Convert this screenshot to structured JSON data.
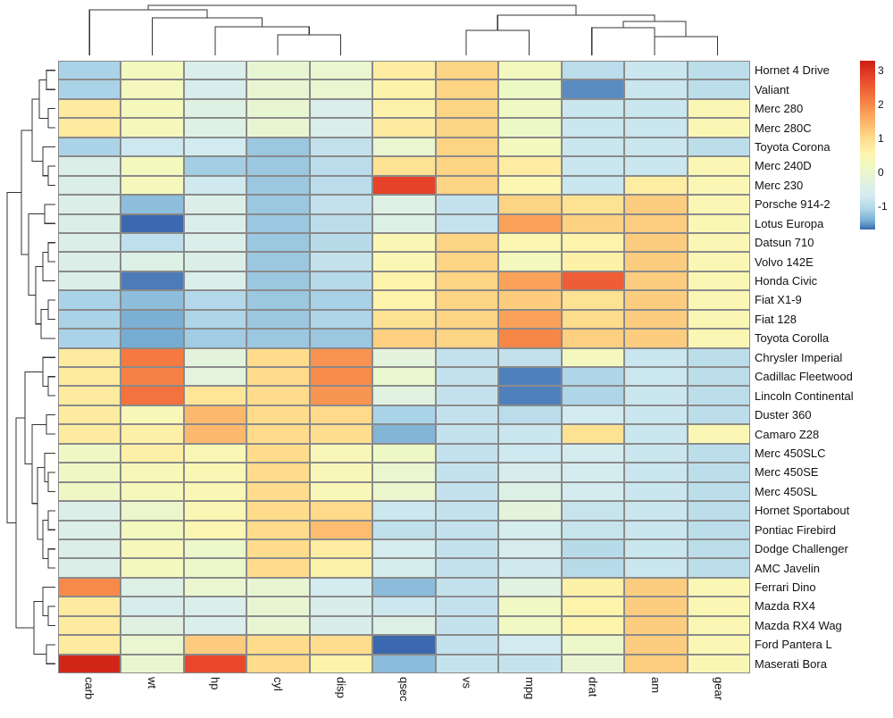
{
  "figure": {
    "type": "clustered-heatmap",
    "title": "",
    "grid_line_color": "#8a8a8a",
    "background": "#ffffff"
  },
  "legend": {
    "name": "color-key",
    "ticks": [
      "3",
      "2",
      "1",
      "0",
      "-1"
    ],
    "tick_values": [
      3,
      2,
      1,
      0,
      -1
    ],
    "scale_min": -1.7,
    "scale_max": 3.3,
    "stops": [
      {
        "pos": 0,
        "color": "#cc1e14"
      },
      {
        "pos": 0.1,
        "color": "#e8442b"
      },
      {
        "pos": 0.22,
        "color": "#f4773f"
      },
      {
        "pos": 0.34,
        "color": "#fbab60"
      },
      {
        "pos": 0.46,
        "color": "#fedd8d"
      },
      {
        "pos": 0.56,
        "color": "#fdf7b0"
      },
      {
        "pos": 0.64,
        "color": "#eef8c6"
      },
      {
        "pos": 0.72,
        "color": "#e2f2e0"
      },
      {
        "pos": 0.8,
        "color": "#d4ecf0"
      },
      {
        "pos": 0.88,
        "color": "#aed5e8"
      },
      {
        "pos": 0.95,
        "color": "#76acd2"
      },
      {
        "pos": 1.0,
        "color": "#3b68ae"
      }
    ]
  },
  "chart_data": {
    "type": "heatmap",
    "title": "",
    "xlabel": "",
    "ylabel": "",
    "zlim": [
      -1.7,
      3.3
    ],
    "grid": true,
    "legend_position": "right",
    "columns": [
      "carb",
      "wt",
      "hp",
      "cyl",
      "disp",
      "qsec",
      "vs",
      "mpg",
      "drat",
      "am",
      "gear"
    ],
    "rows": [
      "Hornet 4 Drive",
      "Valiant",
      "Merc 280",
      "Merc 280C",
      "Toyota Corona",
      "Merc 240D",
      "Merc 230",
      "Porsche 914-2",
      "Lotus Europa",
      "Datsun 710",
      "Volvo 142E",
      "Honda Civic",
      "Fiat X1-9",
      "Fiat 128",
      "Toyota Corolla",
      "Chrysler Imperial",
      "Cadillac Fleetwood",
      "Lincoln Continental",
      "Duster 360",
      "Camaro Z28",
      "Merc 450SLC",
      "Merc 450SE",
      "Merc 450SL",
      "Hornet Sportabout",
      "Pontiac Firebird",
      "Dodge Challenger",
      "AMC Javelin",
      "Ferrari Dino",
      "Mazda RX4",
      "Mazda RX4 Wag",
      "Ford Pantera L",
      "Maserati Bora"
    ],
    "values": [
      [
        -1.12,
        0.23,
        -0.54,
        -0.1,
        -0.06,
        0.72,
        1.12,
        0.22,
        -0.97,
        -0.81,
        -0.95
      ],
      [
        -1.12,
        0.25,
        -0.61,
        -0.1,
        -0.06,
        0.59,
        1.12,
        0.11,
        -1.57,
        -0.81,
        -0.95
      ],
      [
        0.74,
        0.29,
        -0.38,
        -0.1,
        -0.54,
        0.59,
        1.12,
        0.16,
        -0.81,
        -0.81,
        0.43
      ],
      [
        0.74,
        0.29,
        -0.38,
        -0.1,
        -0.54,
        0.73,
        1.12,
        0.1,
        -0.81,
        -0.81,
        0.43
      ],
      [
        -1.12,
        -0.77,
        -0.72,
        -1.22,
        -0.89,
        -0.06,
        1.12,
        0.23,
        -0.81,
        -0.81,
        -0.95
      ],
      [
        -0.5,
        0.24,
        -1.16,
        -1.22,
        -0.96,
        0.9,
        1.12,
        0.71,
        -0.81,
        -0.81,
        0.43
      ],
      [
        -0.5,
        0.28,
        -0.75,
        -1.22,
        -0.96,
        2.83,
        1.12,
        0.45,
        -0.81,
        0.69,
        0.43
      ],
      [
        -0.5,
        -1.3,
        -0.5,
        -1.22,
        -0.89,
        -0.39,
        -0.87,
        1.12,
        0.9,
        1.19,
        0.43
      ],
      [
        -0.5,
        -1.72,
        -0.52,
        -1.22,
        -0.96,
        -0.45,
        -0.87,
        1.72,
        1.15,
        1.19,
        0.43
      ],
      [
        -0.5,
        -0.92,
        -0.53,
        -1.22,
        -0.99,
        0.42,
        1.12,
        0.45,
        0.57,
        1.19,
        0.43
      ],
      [
        -0.5,
        -0.44,
        -0.5,
        -1.22,
        -0.88,
        0.42,
        1.12,
        0.22,
        0.62,
        1.19,
        0.43
      ],
      [
        -0.5,
        -1.63,
        -0.54,
        -1.22,
        -1.02,
        0.58,
        1.12,
        1.7,
        2.5,
        1.19,
        0.43
      ],
      [
        -1.12,
        -1.3,
        -1.05,
        -1.22,
        -1.13,
        0.58,
        1.12,
        1.21,
        0.91,
        1.19,
        0.43
      ],
      [
        -1.12,
        -1.42,
        -1.1,
        -1.22,
        -1.1,
        0.91,
        1.12,
        1.7,
        1.0,
        1.19,
        0.43
      ],
      [
        -1.12,
        -1.45,
        -1.18,
        -1.22,
        -1.22,
        1.16,
        1.12,
        2.02,
        1.17,
        1.19,
        0.43
      ],
      [
        0.74,
        2.17,
        -0.22,
        1.01,
        1.88,
        -0.23,
        -0.87,
        -0.89,
        0.25,
        -0.81,
        -0.95
      ],
      [
        0.74,
        2.08,
        -0.26,
        1.01,
        1.96,
        -0.02,
        -0.87,
        -1.61,
        -1.09,
        -0.81,
        -0.95
      ],
      [
        0.74,
        2.26,
        0.85,
        1.01,
        1.85,
        -0.31,
        -0.87,
        -1.61,
        -1.1,
        -0.81,
        -0.95
      ],
      [
        0.74,
        0.36,
        1.43,
        1.01,
        1.04,
        -1.12,
        -0.87,
        -0.96,
        -0.72,
        -0.81,
        -0.95
      ],
      [
        0.74,
        0.64,
        1.43,
        1.01,
        0.96,
        -1.37,
        -0.87,
        -0.81,
        0.9,
        -0.81,
        0.43
      ],
      [
        0.13,
        0.64,
        0.41,
        1.01,
        0.36,
        0.09,
        -0.87,
        -0.76,
        -0.69,
        -0.81,
        -0.95
      ],
      [
        0.13,
        0.36,
        0.41,
        1.01,
        0.36,
        -0.04,
        -0.87,
        -0.61,
        -0.69,
        -0.81,
        -0.95
      ],
      [
        0.13,
        0.3,
        0.41,
        1.01,
        0.36,
        -0.01,
        -0.87,
        -0.46,
        -0.69,
        -0.81,
        -0.95
      ],
      [
        -0.5,
        -0.01,
        0.41,
        1.01,
        1.04,
        -0.78,
        -0.87,
        -0.22,
        -0.84,
        -0.81,
        -0.95
      ],
      [
        -0.5,
        0.23,
        0.44,
        1.01,
        1.38,
        -0.91,
        -0.87,
        -0.64,
        -0.84,
        -0.81,
        -0.95
      ],
      [
        -0.5,
        0.31,
        0.04,
        1.01,
        0.71,
        -0.66,
        -0.87,
        -0.61,
        -0.99,
        -0.81,
        -0.95
      ],
      [
        -0.5,
        0.23,
        0.04,
        1.01,
        0.59,
        -0.65,
        -0.87,
        -0.75,
        -0.99,
        -0.81,
        -0.95
      ],
      [
        1.98,
        -0.45,
        -0.03,
        -0.1,
        -0.69,
        -1.31,
        -0.87,
        -0.31,
        0.63,
        1.19,
        0.43
      ],
      [
        0.74,
        -0.61,
        -0.54,
        -0.1,
        -0.57,
        -0.78,
        -0.87,
        0.15,
        0.57,
        1.19,
        0.43
      ],
      [
        0.74,
        -0.35,
        -0.54,
        -0.1,
        -0.57,
        -0.46,
        -0.87,
        0.15,
        0.57,
        1.19,
        0.43
      ],
      [
        0.74,
        -0.05,
        1.22,
        1.01,
        0.99,
        -1.82,
        -0.87,
        -0.71,
        0.04,
        1.19,
        0.43
      ],
      [
        3.21,
        -0.02,
        2.75,
        1.01,
        0.57,
        -1.31,
        -0.87,
        -0.86,
        -0.07,
        1.19,
        0.43
      ]
    ]
  },
  "column_dendrogram": {
    "name": "column-dendrogram",
    "leaf_order": [
      "carb",
      "wt",
      "hp",
      "cyl",
      "disp",
      "qsec",
      "vs",
      "mpg",
      "drat",
      "am",
      "gear"
    ],
    "merges": [
      {
        "children": [
          "cyl",
          "disp"
        ],
        "height": 0.13
      },
      {
        "children": [
          "hp",
          "cyl-disp"
        ],
        "height": 0.22
      },
      {
        "children": [
          "wt",
          "hp-cyl-disp"
        ],
        "height": 0.33
      },
      {
        "children": [
          "carb",
          "wt-hp-cyl-disp"
        ],
        "height": 0.5
      },
      {
        "children": [
          "mpg",
          "drat"
        ],
        "height": 0.17
      },
      {
        "children": [
          "am",
          "gear"
        ],
        "height": 0.12
      },
      {
        "children": [
          "mpg-drat",
          "am-gear"
        ],
        "height": 0.26
      },
      {
        "children": [
          "qsec",
          "vs"
        ],
        "height": 0.32
      },
      {
        "children": [
          "qsec-vs",
          "mpg-drat-am-gear"
        ],
        "height": 0.62
      },
      {
        "children": [
          "left-block",
          "right-block"
        ],
        "height": 0.92
      }
    ]
  },
  "row_dendrogram": {
    "name": "row-dendrogram",
    "leaf_order_matches_rows": true
  },
  "row_labels": {
    "name": "row-label-list",
    "font_size_px": 13
  },
  "column_labels": {
    "name": "column-label-list",
    "orientation": "vertical",
    "font_size_px": 13
  }
}
